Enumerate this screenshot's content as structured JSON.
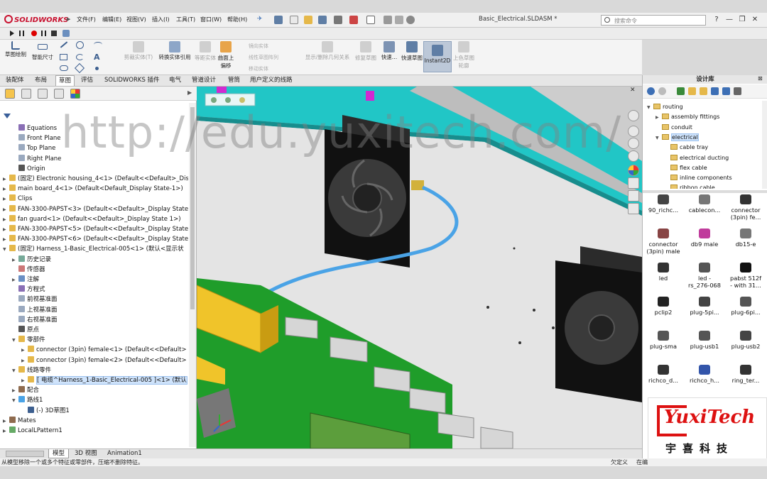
{
  "app": {
    "brand": "SOLIDWORKS",
    "document_title": "Basic_Electrical.SLDASM *"
  },
  "menu": [
    "文件(F)",
    "编辑(E)",
    "视图(V)",
    "插入(I)",
    "工具(T)",
    "窗口(W)",
    "帮助(H)"
  ],
  "search": {
    "placeholder": "搜索命令"
  },
  "window_controls": [
    "?",
    "—",
    "❐",
    "✕"
  ],
  "ribbon": {
    "sketch": "草图绘制",
    "smart_dim": "智能尺寸",
    "trim": "剪裁实体(T)",
    "convert": "转换实体引用",
    "offset_surface": "等距实体",
    "offset_on_surface": "曲面上偏移",
    "mirror": "镜向实体",
    "linear_pattern": "线性草图阵列",
    "move": "移动实体",
    "show_relations": "显示/删除几何关系",
    "repair": "修复草图",
    "quick_snap": "快速…",
    "quick_sketch": "快速草图",
    "instant2d": "Instant2D",
    "shaded_sketch": "上色草图轮廓"
  },
  "tabs": [
    "装配体",
    "布局",
    "草图",
    "评估",
    "SOLIDWORKS 插件",
    "电气",
    "管道设计",
    "管筒",
    "用户定义的线路"
  ],
  "active_tab": "草图",
  "tree": [
    {
      "label": "Equations",
      "depth": 1,
      "arrow": "",
      "icon": "eq"
    },
    {
      "label": "Front Plane",
      "depth": 1,
      "arrow": "",
      "icon": "plane"
    },
    {
      "label": "Top Plane",
      "depth": 1,
      "arrow": "",
      "icon": "plane"
    },
    {
      "label": "Right Plane",
      "depth": 1,
      "arrow": "",
      "icon": "plane"
    },
    {
      "label": "Origin",
      "depth": 1,
      "arrow": "",
      "icon": "origin"
    },
    {
      "label": "(固定) Electronic housing_4<1> (Default<<Default>_Dis",
      "depth": 0,
      "arrow": "▶",
      "icon": "part"
    },
    {
      "label": "main board_4<1> (Default<Default_Display State-1>)",
      "depth": 0,
      "arrow": "▶",
      "icon": "part"
    },
    {
      "label": "Clips",
      "depth": 0,
      "arrow": "▶",
      "icon": "folder"
    },
    {
      "label": "FAN-3300-PAPST<3> (Default<<Default>_Display State",
      "depth": 0,
      "arrow": "▶",
      "icon": "part"
    },
    {
      "label": "fan guard<1> (Default<<Default>_Display State 1>)",
      "depth": 0,
      "arrow": "▶",
      "icon": "part"
    },
    {
      "label": "FAN-3300-PAPST<5> (Default<<Default>_Display State",
      "depth": 0,
      "arrow": "▶",
      "icon": "part"
    },
    {
      "label": "FAN-3300-PAPST<6> (Default<<Default>_Display State",
      "depth": 0,
      "arrow": "▶",
      "icon": "part"
    },
    {
      "label": "(固定) Harness_1-Basic_Electrical-005<1> (默认<显示状",
      "depth": 0,
      "arrow": "▼",
      "icon": "part"
    },
    {
      "label": "历史记录",
      "depth": 1,
      "arrow": "▶",
      "icon": "hist"
    },
    {
      "label": "传感器",
      "depth": 1,
      "arrow": "",
      "icon": "sensor"
    },
    {
      "label": "注解",
      "depth": 1,
      "arrow": "▶",
      "icon": "annot"
    },
    {
      "label": "方程式",
      "depth": 1,
      "arrow": "",
      "icon": "eq"
    },
    {
      "label": "前视基准面",
      "depth": 1,
      "arrow": "",
      "icon": "plane"
    },
    {
      "label": "上视基准面",
      "depth": 1,
      "arrow": "",
      "icon": "plane"
    },
    {
      "label": "右视基准面",
      "depth": 1,
      "arrow": "",
      "icon": "plane"
    },
    {
      "label": "原点",
      "depth": 1,
      "arrow": "",
      "icon": "origin"
    },
    {
      "label": "零部件",
      "depth": 1,
      "arrow": "▼",
      "icon": "folder"
    },
    {
      "label": "connector (3pin) female<1> (Default<<Default>",
      "depth": 2,
      "arrow": "▶",
      "icon": "part"
    },
    {
      "label": "connector (3pin) female<2> (Default<<Default>",
      "depth": 2,
      "arrow": "▶",
      "icon": "part"
    },
    {
      "label": "线路零件",
      "depth": 1,
      "arrow": "▼",
      "icon": "folder"
    },
    {
      "label": "[ 电缆^Harness_1-Basic_Electrical-005 ]<1> (默认",
      "depth": 2,
      "arrow": "▶",
      "icon": "part",
      "selected": true
    },
    {
      "label": "配合",
      "depth": 1,
      "arrow": "▶",
      "icon": "mate"
    },
    {
      "label": "路线1",
      "depth": 1,
      "arrow": "▼",
      "icon": "route"
    },
    {
      "label": "(-) 3D草图1",
      "depth": 2,
      "arrow": "",
      "icon": "sketch3d"
    },
    {
      "label": "Mates",
      "depth": 0,
      "arrow": "▶",
      "icon": "mate"
    },
    {
      "label": "LocalLPattern1",
      "depth": 0,
      "arrow": "▶",
      "icon": "pattern"
    }
  ],
  "bottom_tabs": [
    "模型",
    "3D 视图",
    "Animation1"
  ],
  "active_bottom_tab": "模型",
  "status": {
    "message": "从模型移除一个或多个特征或零部件，压缩不删除特征。",
    "state": "欠定义",
    "edit": "在编"
  },
  "design_library": {
    "title": "设计库",
    "folders": [
      {
        "label": "routing",
        "depth": 0,
        "arrow": "▼"
      },
      {
        "label": "assembly fittings",
        "depth": 1,
        "arrow": "▶"
      },
      {
        "label": "conduit",
        "depth": 1,
        "arrow": ""
      },
      {
        "label": "electrical",
        "depth": 1,
        "arrow": "▼",
        "selected": true
      },
      {
        "label": "cable tray",
        "depth": 2,
        "arrow": ""
      },
      {
        "label": "electrical ducting",
        "depth": 2,
        "arrow": ""
      },
      {
        "label": "flex cable",
        "depth": 2,
        "arrow": ""
      },
      {
        "label": "inline components",
        "depth": 2,
        "arrow": ""
      },
      {
        "label": "ribbon cable",
        "depth": 2,
        "arrow": ""
      }
    ],
    "items": [
      [
        "90_richc...",
        "cablecon...",
        "connector\n(3pin) fe..."
      ],
      [
        "connector\n(3pin) male",
        "db9 male",
        "db15-e"
      ],
      [
        "led",
        "led -\nrs_276-068",
        "pabst 512f\n- with 31..."
      ],
      [
        "pclip2",
        "plug-5pi...",
        "plug-6pi..."
      ],
      [
        "plug-sma",
        "plug-usb1",
        "plug-usb2"
      ],
      [
        "richco_d...",
        "richco_h...",
        "ring_ter..."
      ]
    ]
  },
  "watermark": {
    "text": "http://edu.yuxitech.com/",
    "brand": "YuxiTech",
    "brand_cn": "宇喜科技"
  },
  "colors": {
    "accent": "#5f7ea5",
    "brand_red": "#c8102e",
    "board_green": "#1f9d2a",
    "panel_cyan": "#21c6c6"
  }
}
